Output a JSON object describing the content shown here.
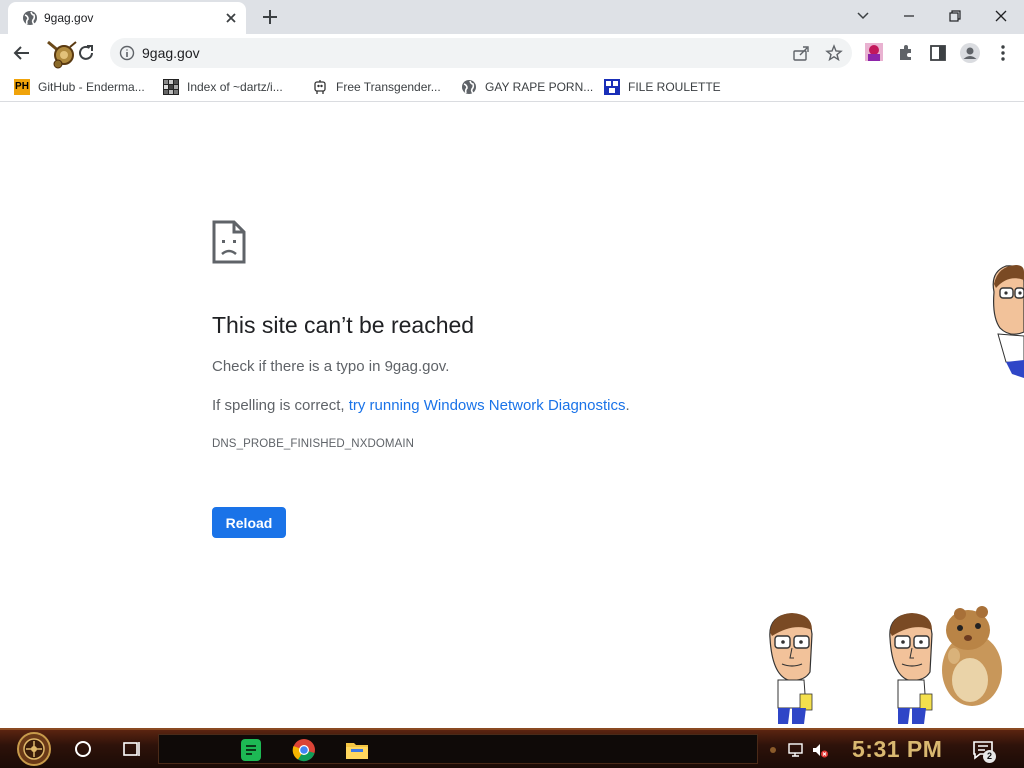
{
  "tab": {
    "title": "9gag.gov"
  },
  "omnibox": {
    "url": "9gag.gov"
  },
  "bookmarks": [
    {
      "label": "GitHub - Enderma...",
      "icon": "ph-icon"
    },
    {
      "label": "Index of ~dartz/i...",
      "icon": "mosaic-icon"
    },
    {
      "label": "Free Transgender...",
      "icon": "robot-icon"
    },
    {
      "label": "GAY RAPE PORN...",
      "icon": "globe-icon"
    },
    {
      "label": "FILE ROULETTE",
      "icon": "film-icon"
    }
  ],
  "bookmark_ph_text": "PH",
  "error": {
    "title": "This site can’t be reached",
    "line1": "Check if there is a typo in 9gag.gov.",
    "line2_prefix": "If spelling is correct, ",
    "line2_link": "try running Windows Network Diagnostics",
    "line2_suffix": ".",
    "code": "DNS_PROBE_FINISHED_NXDOMAIN",
    "reload_label": "Reload"
  },
  "taskbar": {
    "clock": "5:31 PM",
    "notification_count": "2"
  },
  "colors": {
    "accent": "#1a73e8",
    "tabstrip": "#dee1e6",
    "clock": "#d9b870"
  }
}
